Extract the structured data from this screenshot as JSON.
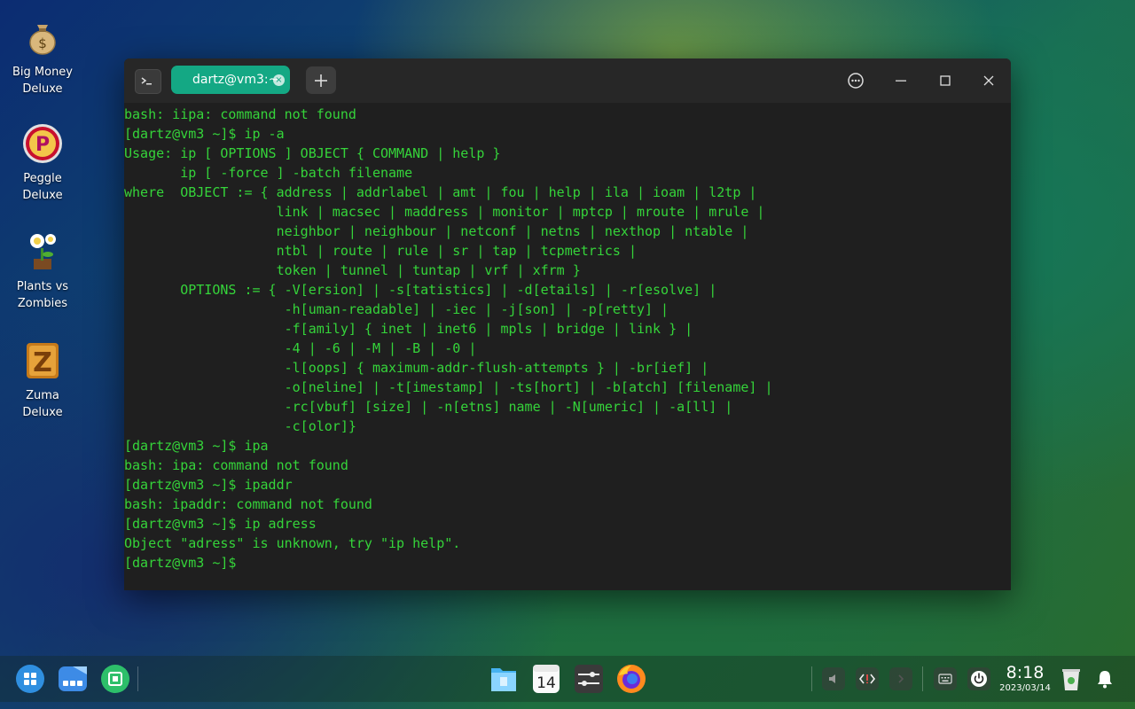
{
  "desktop": {
    "icons": [
      {
        "label": "Big Money\nDeluxe",
        "icon": "money-bag-icon"
      },
      {
        "label": "Peggle\nDeluxe",
        "icon": "peggle-icon"
      },
      {
        "label": "Plants vs\nZombies",
        "icon": "plants-vs-zombies-icon"
      },
      {
        "label": "Zuma\nDeluxe",
        "icon": "zuma-icon"
      }
    ]
  },
  "terminal": {
    "tab_title": "dartz@vm3:~",
    "lines": [
      "bash: iipa: command not found",
      "[dartz@vm3 ~]$ ip -a",
      "Usage: ip [ OPTIONS ] OBJECT { COMMAND | help }",
      "       ip [ -force ] -batch filename",
      "where  OBJECT := { address | addrlabel | amt | fou | help | ila | ioam | l2tp |",
      "                   link | macsec | maddress | monitor | mptcp | mroute | mrule |",
      "                   neighbor | neighbour | netconf | netns | nexthop | ntable |",
      "                   ntbl | route | rule | sr | tap | tcpmetrics |",
      "                   token | tunnel | tuntap | vrf | xfrm }",
      "       OPTIONS := { -V[ersion] | -s[tatistics] | -d[etails] | -r[esolve] |",
      "                    -h[uman-readable] | -iec | -j[son] | -p[retty] |",
      "                    -f[amily] { inet | inet6 | mpls | bridge | link } |",
      "                    -4 | -6 | -M | -B | -0 |",
      "                    -l[oops] { maximum-addr-flush-attempts } | -br[ief] |",
      "                    -o[neline] | -t[imestamp] | -ts[hort] | -b[atch] [filename] |",
      "                    -rc[vbuf] [size] | -n[etns] name | -N[umeric] | -a[ll] |",
      "                    -c[olor]}",
      "[dartz@vm3 ~]$ ipa",
      "bash: ipa: command not found",
      "[dartz@vm3 ~]$ ipaddr",
      "bash: ipaddr: command not found",
      "[dartz@vm3 ~]$ ip adress",
      "Object \"adress\" is unknown, try \"ip help\".",
      "[dartz@vm3 ~]$ "
    ],
    "text_color": "#35d43a",
    "background": "#1f1f1f"
  },
  "taskbar": {
    "left_icons": [
      "launcher-icon",
      "multitask-view-icon",
      "app-store-icon"
    ],
    "center_icons": [
      "file-manager-icon",
      "calendar-icon",
      "control-center-icon",
      "firefox-icon"
    ],
    "calendar_day": "14",
    "tray_icons": [
      "speaker-icon",
      "code-icon",
      "arrow-right-icon",
      "keyboard-icon",
      "power-icon",
      "trash-icon",
      "notification-icon"
    ],
    "clock_time": "8:18",
    "clock_date": "2023/03/14"
  },
  "colors": {
    "accent": "#14a884"
  }
}
